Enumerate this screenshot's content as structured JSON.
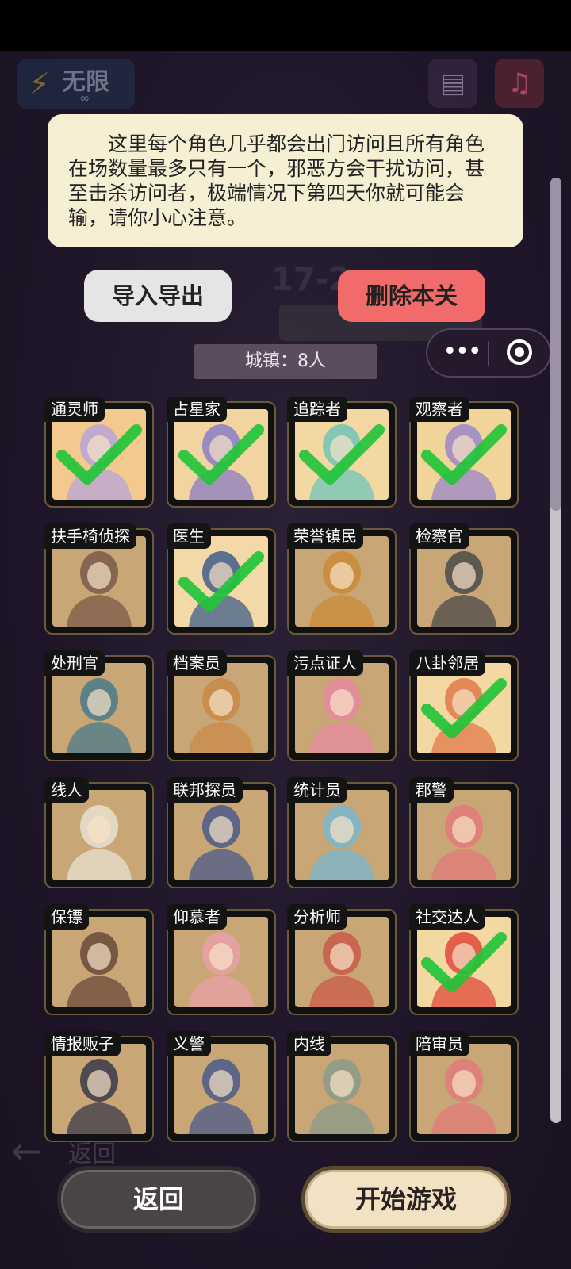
{
  "hud": {
    "energy_label": "无限",
    "energy_value": "∞",
    "energy_icon": "lightning-icon",
    "notes_icon": "notes-icon",
    "music_icon": "music-note-icon"
  },
  "tooltip_text": "这里每个角色几乎都会出门访问且所有角色在场数量最多只有一个，邪恶方会干扰访问，甚至击杀访问者，极端情况下第四天你就可能会输，请你小心注意。",
  "actions": {
    "import_export": "导入导出",
    "delete_level": "删除本关"
  },
  "background": {
    "level_code": "17-2",
    "back_text": "返回"
  },
  "capsule": {
    "more_icon": "more-dots-icon",
    "close_icon": "record-close-icon"
  },
  "town_label": "城镇：8人",
  "roles": [
    {
      "name": "通灵师",
      "selected": true,
      "tone": "#f4c98e",
      "fig": "#b7a4d8"
    },
    {
      "name": "占星家",
      "selected": true,
      "tone": "#f1d4a0",
      "fig": "#8a7cc4"
    },
    {
      "name": "追踪者",
      "selected": true,
      "tone": "#f3d8a2",
      "fig": "#6fc6b8"
    },
    {
      "name": "观察者",
      "selected": true,
      "tone": "#f0d49a",
      "fig": "#9a86c8"
    },
    {
      "name": "扶手椅侦探",
      "selected": false,
      "tone": "#c9a675",
      "fig": "#7a5a4a"
    },
    {
      "name": "医生",
      "selected": true,
      "tone": "#f3d9a8",
      "fig": "#3f5d8a"
    },
    {
      "name": "荣誉镇民",
      "selected": false,
      "tone": "#c9a675",
      "fig": "#c98a3a"
    },
    {
      "name": "检察官",
      "selected": false,
      "tone": "#c9a675",
      "fig": "#4a4a4a"
    },
    {
      "name": "处刑官",
      "selected": false,
      "tone": "#c9a675",
      "fig": "#4a7a8a"
    },
    {
      "name": "档案员",
      "selected": false,
      "tone": "#c9a675",
      "fig": "#c88a4a"
    },
    {
      "name": "污点证人",
      "selected": false,
      "tone": "#c9a675",
      "fig": "#e58aa0"
    },
    {
      "name": "八卦邻居",
      "selected": true,
      "tone": "#f3d8a2",
      "fig": "#e07a4a"
    },
    {
      "name": "线人",
      "selected": false,
      "tone": "#c9a675",
      "fig": "#e8e1d0"
    },
    {
      "name": "联邦探员",
      "selected": false,
      "tone": "#c9a675",
      "fig": "#4a5a8a"
    },
    {
      "name": "统计员",
      "selected": false,
      "tone": "#c9a675",
      "fig": "#7ab6d0"
    },
    {
      "name": "郡警",
      "selected": false,
      "tone": "#c9a675",
      "fig": "#e07a7a"
    },
    {
      "name": "保镖",
      "selected": false,
      "tone": "#c9a675",
      "fig": "#6a4a3a"
    },
    {
      "name": "仰慕者",
      "selected": false,
      "tone": "#c9a675",
      "fig": "#e8a0a8"
    },
    {
      "name": "分析师",
      "selected": false,
      "tone": "#c9a675",
      "fig": "#c85a4a"
    },
    {
      "name": "社交达人",
      "selected": true,
      "tone": "#f3d8a2",
      "fig": "#e04a3a"
    },
    {
      "name": "情报贩子",
      "selected": false,
      "tone": "#c9a675",
      "fig": "#3a3a4a"
    },
    {
      "name": "义警",
      "selected": false,
      "tone": "#c9a675",
      "fig": "#4a5a8a"
    },
    {
      "name": "内线",
      "selected": false,
      "tone": "#c9a675",
      "fig": "#8a9a8a"
    },
    {
      "name": "陪审员",
      "selected": false,
      "tone": "#c9a675",
      "fig": "#e07a7a"
    }
  ],
  "footer": {
    "back": "返回",
    "start": "开始游戏"
  }
}
